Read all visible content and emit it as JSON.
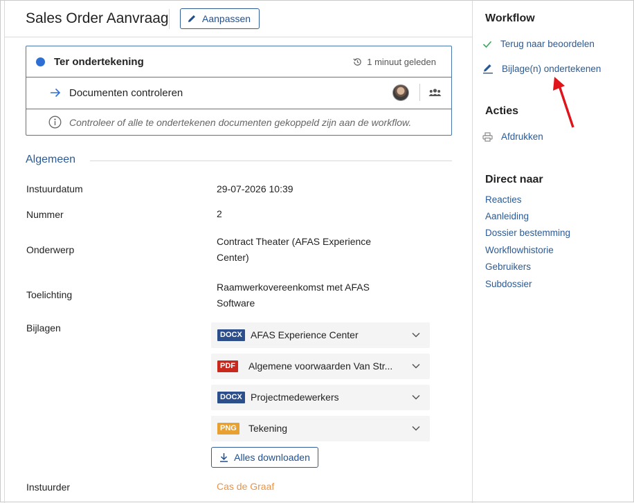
{
  "header": {
    "title": "Sales Order Aanvraag",
    "edit_label": "Aanpassen"
  },
  "status": {
    "state": "Ter ondertekening",
    "time": "1 minuut geleden",
    "task": "Documenten controleren",
    "note": "Controleer of alle te ondertekenen documenten gekoppeld zijn aan de workflow."
  },
  "section": {
    "title": "Algemeen"
  },
  "fields": {
    "instuurdatum": {
      "label": "Instuurdatum",
      "value": "29-07-2026 10:39"
    },
    "nummer": {
      "label": "Nummer",
      "value": "2"
    },
    "onderwerp": {
      "label": "Onderwerp",
      "value": "Contract Theater (AFAS Experience Center)"
    },
    "toelichting": {
      "label": "Toelichting",
      "value": "Raamwerkovereenkomst met AFAS Software"
    },
    "bijlagen": {
      "label": "Bijlagen"
    },
    "instuurder": {
      "label": "Instuurder",
      "value": "Cas de Graaf"
    }
  },
  "attachments": [
    {
      "type": "DOCX",
      "name": "AFAS Experience Center",
      "color": "#2c4f8c"
    },
    {
      "type": "PDF",
      "name": "Algemene voorwaarden Van Str...",
      "color": "#c8291c"
    },
    {
      "type": "DOCX",
      "name": "Projectmedewerkers",
      "color": "#2c4f8c"
    },
    {
      "type": "PNG",
      "name": "Tekening",
      "color": "#e8a030"
    }
  ],
  "download_all_label": "Alles downloaden",
  "sidebar": {
    "workflow_title": "Workflow",
    "workflow_items": [
      {
        "label": "Terug naar beoordelen",
        "icon": "check-icon"
      },
      {
        "label": "Bijlage(n) ondertekenen",
        "icon": "pencil-icon"
      }
    ],
    "acties_title": "Acties",
    "acties_items": [
      {
        "label": "Afdrukken",
        "icon": "printer-icon"
      }
    ],
    "direct_title": "Direct naar",
    "direct_items": [
      "Reacties",
      "Aanleiding",
      "Dossier bestemming",
      "Workflowhistorie",
      "Gebruikers",
      "Subdossier"
    ]
  },
  "colors": {
    "accent": "#2a5a95",
    "status_dot": "#2e6fd6",
    "submitter": "#e8944a",
    "annotation_arrow": "#e0141b"
  }
}
